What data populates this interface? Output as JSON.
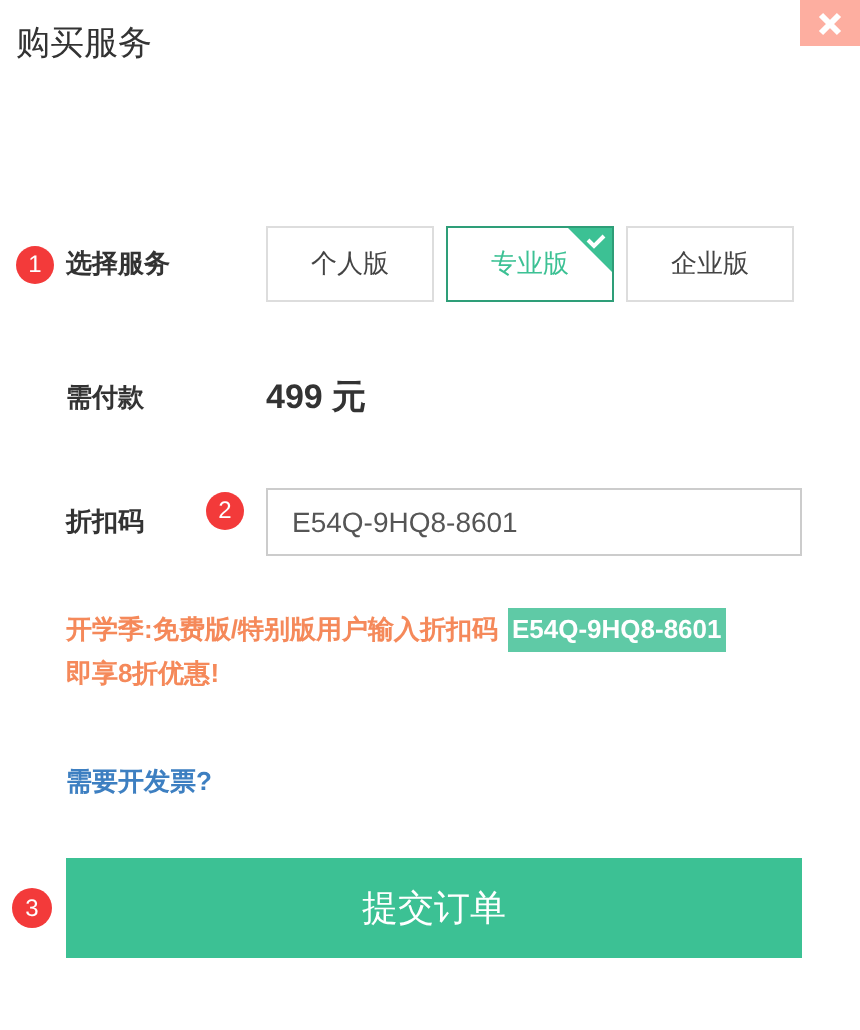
{
  "window": {
    "title": "购买服务"
  },
  "service": {
    "step": "1",
    "label": "选择服务",
    "options": [
      {
        "label": "个人版",
        "selected": false
      },
      {
        "label": "专业版",
        "selected": true
      },
      {
        "label": "企业版",
        "selected": false
      }
    ]
  },
  "payment": {
    "label": "需付款",
    "amount": "499 元"
  },
  "discount": {
    "label": "折扣码",
    "step": "2",
    "value": "E54Q-9HQ8-8601"
  },
  "promo": {
    "text": "开学季:免费版/特别版用户输入折扣码",
    "code": "E54Q-9HQ8-8601",
    "text_after": "即享8折优惠!"
  },
  "invoice_link": "需要开发票?",
  "submit": {
    "step": "3",
    "label": "提交订单"
  }
}
